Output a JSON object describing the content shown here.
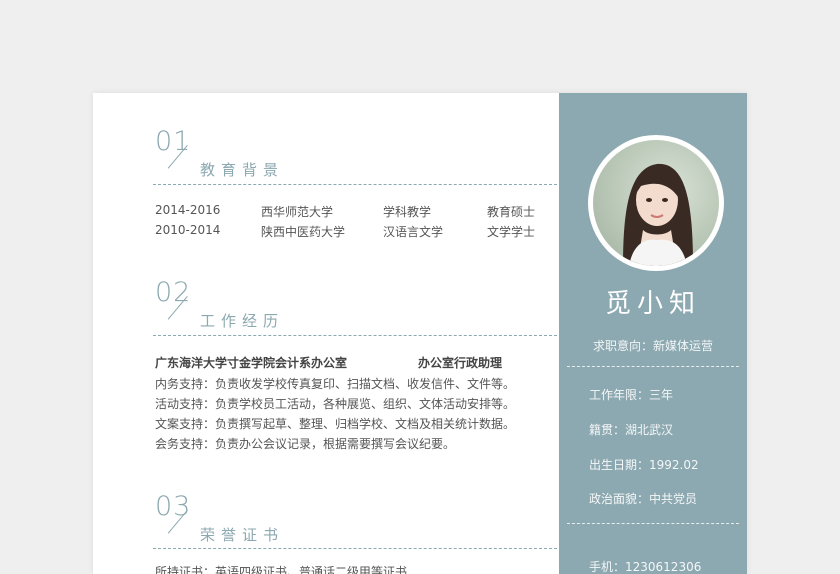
{
  "education": {
    "num": "01",
    "title": "教育背景",
    "rows": [
      {
        "period": "2014-2016",
        "school": "西华师范大学",
        "major": "学科教学",
        "degree": "教育硕士"
      },
      {
        "period": "2010-2014",
        "school": "陕西中医药大学",
        "major": "汉语言文学",
        "degree": "文学学士"
      }
    ]
  },
  "work": {
    "num": "02",
    "title": "工作经历",
    "company": "广东海洋大学寸金学院会计系办公室",
    "position": "办公室行政助理",
    "duties": [
      "内务支持：负责收发学校传真复印、扫描文档、收发信件、文件等。",
      "活动支持：负责学校员工活动，各种展览、组织、文体活动安排等。",
      "文案支持：负责撰写起草、整理、归档学校、文档及相关统计数据。",
      "会务支持：负责办公会议记录，根据需要撰写会议纪要。"
    ]
  },
  "honors": {
    "num": "03",
    "title": "荣誉证书",
    "line1": "所持证书：英语四级证书、普通话二级甲等证书"
  },
  "profile": {
    "name": "觅小知",
    "intent": "求职意向：新媒体运营",
    "work_years": "工作年限：三年",
    "hometown": "籍贯：湖北武汉",
    "birth": "出生日期：1992.02",
    "politics": "政治面貌：中共党员",
    "phone": "手机：1230612306"
  },
  "colors": {
    "accent": "#8ca8b0",
    "page_bg": "#efefef",
    "paper": "#ffffff"
  }
}
